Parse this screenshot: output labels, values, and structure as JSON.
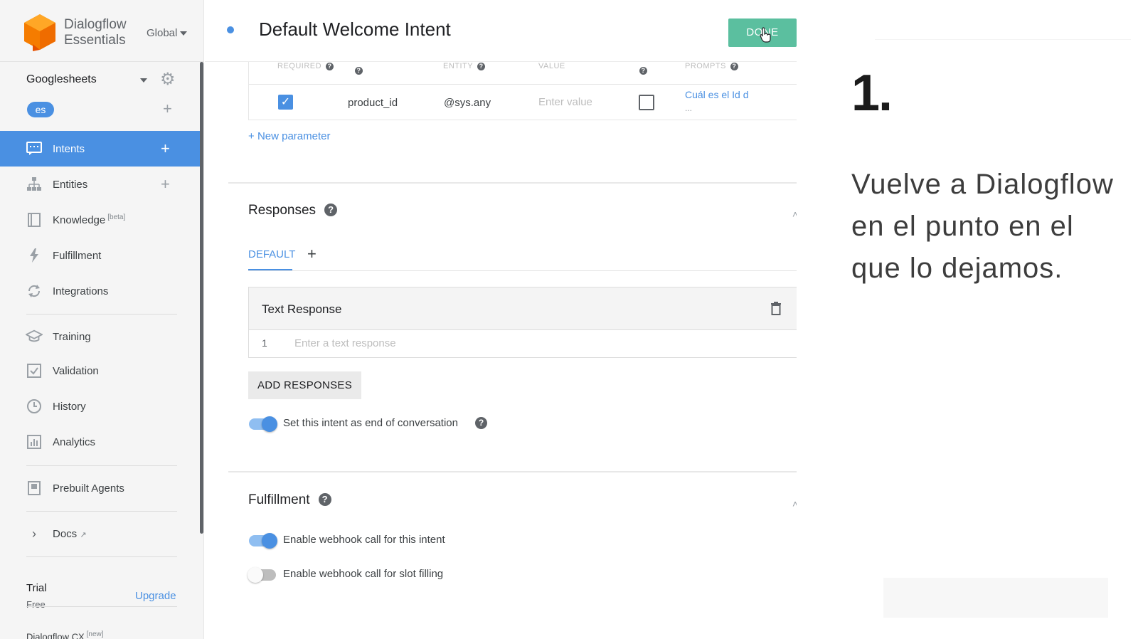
{
  "brand": {
    "name_line1": "Dialogflow",
    "name_line2": "Essentials",
    "region": "Global"
  },
  "agent": {
    "name": "Googlesheets",
    "language": "es"
  },
  "nav": {
    "intents": "Intents",
    "entities": "Entities",
    "knowledge": "Knowledge",
    "knowledge_badge": "[beta]",
    "fulfillment": "Fulfillment",
    "integrations": "Integrations",
    "training": "Training",
    "validation": "Validation",
    "history": "History",
    "analytics": "Analytics",
    "prebuilt": "Prebuilt Agents",
    "docs": "Docs"
  },
  "plan": {
    "label": "Trial",
    "sub": "Free",
    "upgrade": "Upgrade",
    "cx": "Dialogflow CX",
    "cx_badge": "[new]"
  },
  "header": {
    "title": "Default Welcome Intent",
    "done": "DONE"
  },
  "params": {
    "headers": {
      "required": "REQUIRED",
      "entity": "ENTITY",
      "value": "VALUE",
      "prompts": "PROMPTS"
    },
    "row": {
      "required": true,
      "name": "product_id",
      "entity": "@sys.any",
      "value_placeholder": "Enter value",
      "is_list": false,
      "prompt": "Cuál es el Id d",
      "prompt_more": "..."
    },
    "new_parameter": "New parameter"
  },
  "responses": {
    "title": "Responses",
    "tab_default": "DEFAULT",
    "card_title": "Text Response",
    "row_number": "1",
    "input_placeholder": "Enter a text response",
    "add_button": "ADD RESPONSES",
    "end_conversation_label": "Set this intent as end of conversation",
    "end_conversation_on": true
  },
  "fulfillment": {
    "title": "Fulfillment",
    "webhook_label": "Enable webhook call for this intent",
    "webhook_on": true,
    "slot_label": "Enable webhook call for slot filling",
    "slot_on": false
  },
  "overlay": {
    "step_number": "1.",
    "step_text": "Vuelve a Dialogflow en el punto en el que lo dejamos."
  },
  "colors": {
    "accent": "#4a90e2",
    "done": "#5bbf9f",
    "logo": "#ef6c00"
  }
}
